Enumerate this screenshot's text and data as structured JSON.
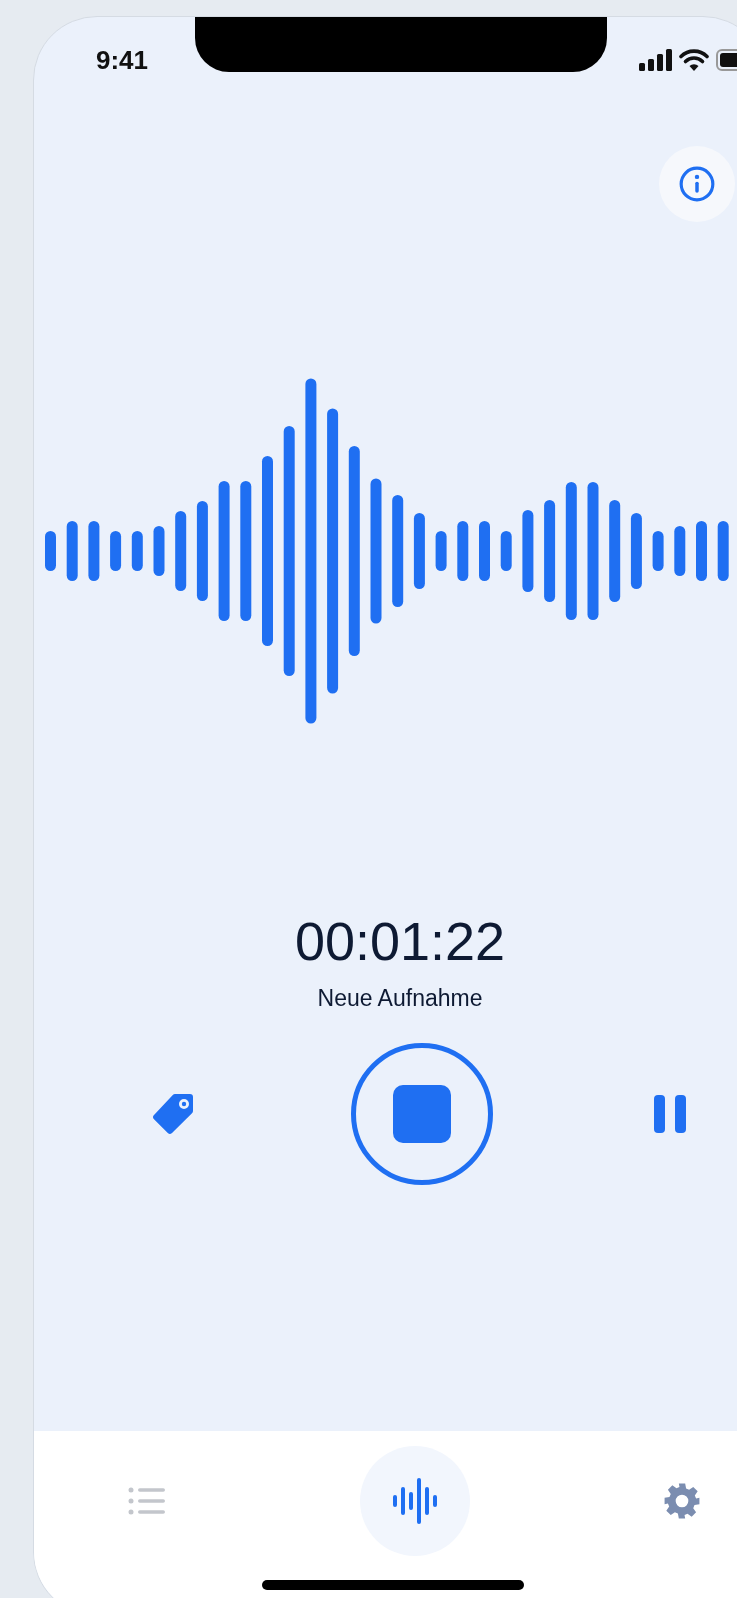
{
  "status_bar": {
    "time": "9:41"
  },
  "recording": {
    "elapsed": "00:01:22",
    "title": "Neue Aufnahme"
  },
  "tab_bar": {
    "tabs": [
      {
        "kind": "list",
        "selected": false
      },
      {
        "kind": "record",
        "selected": true
      },
      {
        "kind": "settings",
        "selected": false
      }
    ]
  }
}
